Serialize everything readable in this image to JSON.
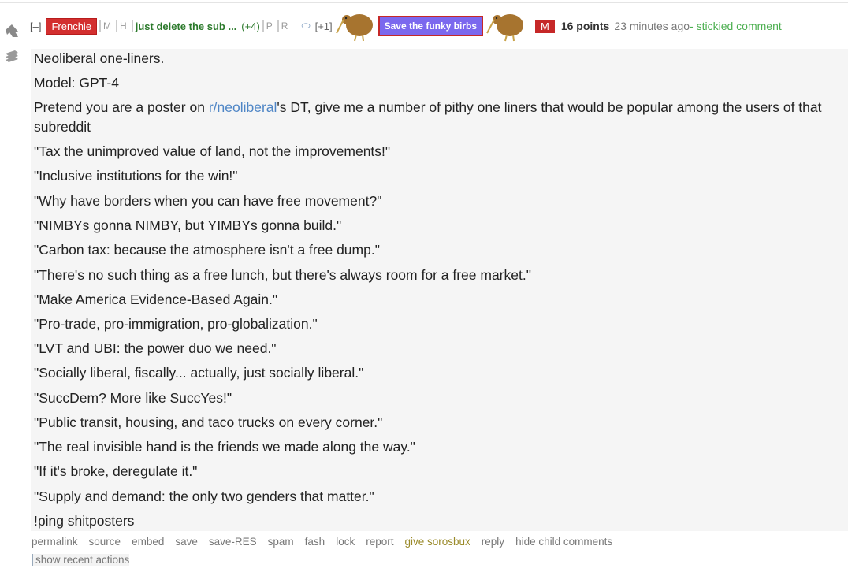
{
  "comment": {
    "collapse_label": "[–]",
    "author": "Frenchie",
    "flag_m": "M",
    "flag_h": "H",
    "flair_text": "just delete the sub ...",
    "flair_count": "(+4)",
    "flag_p": "P",
    "flag_r": "R",
    "tag_plus": "[+1]",
    "special_flair": "Save the funky birbs",
    "mod_badge": "M",
    "points": "16 points",
    "time": "23 minutes ago",
    "stickied": "- stickied comment"
  },
  "body": {
    "title": "Neoliberal one-liners.",
    "model": "Model: GPT-4",
    "prompt_before": "Pretend you are a poster on ",
    "prompt_link": "r/neoliberal",
    "prompt_after_1": "'s DT, give me a number of pithy one liners that would be popular among the users of that",
    "prompt_after_2": "subreddit",
    "lines": [
      "\"Tax the unimproved value of land, not the improvements!\"",
      "\"Inclusive institutions for the win!\"",
      "\"Why have borders when you can have free movement?\"",
      "\"NIMBYs gonna NIMBY, but YIMBYs gonna build.\"",
      "\"Carbon tax: because the atmosphere isn't a free dump.\"",
      "\"There's no such thing as a free lunch, but there's always room for a free market.\"",
      "\"Make America Evidence-Based Again.\"",
      "\"Pro-trade, pro-immigration, pro-globalization.\"",
      "\"LVT and UBI: the power duo we need.\"",
      "\"Socially liberal, fiscally... actually, just socially liberal.\"",
      "\"SuccDem? More like SuccYes!\"",
      "\"Public transit, housing, and taco trucks on every corner.\"",
      "\"The real invisible hand is the friends we made along the way.\"",
      "\"If it's broke, deregulate it.\"",
      "\"Supply and demand: the only two genders that matter.\""
    ],
    "ping": "!ping shitposters"
  },
  "actions": [
    "permalink",
    "source",
    "embed",
    "save",
    "save-RES",
    "spam",
    "fash",
    "lock",
    "report",
    "give sorosbux",
    "reply",
    "hide child comments"
  ],
  "recent": "show recent actions",
  "colors": {
    "author_bg": "#d32f2f",
    "flair_green": "#2c7a2c",
    "funky_bg": "#7b68ee",
    "link_blue": "#4f86c6",
    "stickied_green": "#4caf50"
  }
}
